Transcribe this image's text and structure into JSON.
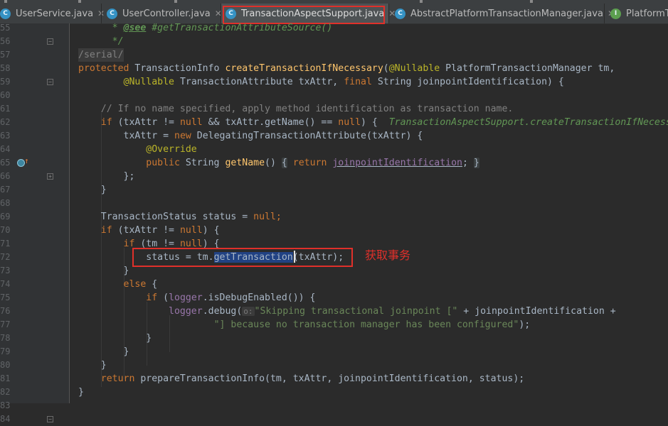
{
  "tabs": [
    {
      "label": "UserService.java",
      "icon": "class-icon",
      "active": false
    },
    {
      "label": "UserController.java",
      "icon": "class-icon",
      "active": false
    },
    {
      "label": "TransactionAspectSupport.java",
      "icon": "class-icon",
      "active": true
    },
    {
      "label": "AbstractPlatformTransactionManager.java",
      "icon": "class-icon",
      "active": false
    },
    {
      "label": "PlatformT",
      "icon": "interface-icon",
      "active": false
    }
  ],
  "line_numbers": [
    "55",
    "56",
    "57",
    "58",
    "59",
    "60",
    "61",
    "62",
    "63",
    "64",
    "65",
    "66",
    "67",
    "68",
    "69",
    "70",
    "71",
    "72",
    "73",
    "74",
    "75",
    "76",
    "77",
    "78",
    "79",
    "80",
    "81",
    "82",
    "83",
    "84"
  ],
  "code": {
    "l55_a": " * ",
    "l55_tag": "@see",
    "l55_b": " #getTransactionAttributeSource()",
    "l56": " */",
    "l57": "/serial/",
    "l58_kw": "protected",
    "l58_a": " TransactionInfo ",
    "l58_fn": "createTransactionIfNecessary",
    "l58_b": "(",
    "l58_ann": "@Nullable",
    "l58_c": " PlatformTransactionManager tm,",
    "l59_ann": "@Nullable",
    "l59_a": " TransactionAttribute txAttr, ",
    "l59_kw": "final",
    "l59_b": " String joinpointIdentification) {",
    "l61": "// If no name specified, apply method identification as transaction name.",
    "l62_kw": "if",
    "l62_a": " (txAttr != ",
    "l62_n1": "null",
    "l62_b": " && txAttr.getName() == ",
    "l62_n2": "null",
    "l62_c": ") {  ",
    "l62_hint": "TransactionAspectSupport.createTransactionIfNecessary",
    "l63_a": "txAttr = ",
    "l63_kw": "new",
    "l63_b": " DelegatingTransactionAttribute(txAttr) {",
    "l64_ann": "@Override",
    "l65_kw": "public",
    "l65_a": " String ",
    "l65_fn": "getName",
    "l65_b": "() ",
    "l65_fo": "{",
    "l65_kw2": "return",
    "l65_c": " ",
    "l65_fld": "joinpointIdentification",
    "l65_d": "; ",
    "l65_fc": "}",
    "l66": "};",
    "l67": "}",
    "l69_a": "TransactionStatus status = ",
    "l69_kw": "null",
    "l69_b": ";",
    "l70_kw": "if",
    "l70_a": " (txAttr != ",
    "l70_kw2": "null",
    "l70_b": ") {",
    "l71_kw": "if",
    "l71_a": " (tm != ",
    "l71_kw2": "null",
    "l71_b": ") {",
    "l72_a": "status = tm.",
    "l72_sel": "getTransaction",
    "l72_b": "(txAttr);",
    "l73": "}",
    "l74_kw": "else",
    "l74_a": " {",
    "l75_kw": "if",
    "l75_a": " (",
    "l75_fld": "logger",
    "l75_b": ".isDebugEnabled()) {",
    "l76_fld": "logger",
    "l76_a": ".debug(",
    "l76_prm": "o:",
    "l76_str": "\"Skipping transactional joinpoint [\"",
    "l76_b": " + joinpointIdentification +",
    "l77_str": "\"] because no transaction manager has been configured\"",
    "l77_a": ");",
    "l78": "}",
    "l79": "}",
    "l80": "}",
    "l81_kw": "return",
    "l81_a": " prepareTransactionInfo(tm, txAttr, joinpointIdentification, status);",
    "l82": "}"
  },
  "annotation_note": "获取事务",
  "colors": {
    "highlight_red": "#e0302a",
    "keyword": "#cc7832",
    "method": "#ffc66d",
    "string": "#6a8759",
    "field": "#9876aa"
  }
}
